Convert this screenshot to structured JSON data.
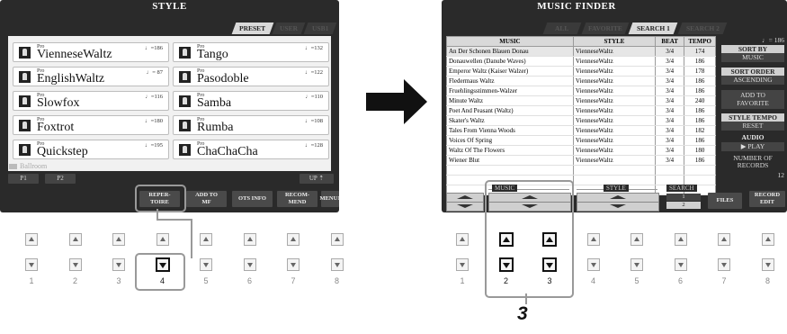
{
  "left_screen": {
    "title": "STYLE",
    "tabs": [
      {
        "label": "PRESET",
        "active": true
      },
      {
        "label": "USER",
        "active": false
      },
      {
        "label": "USB1",
        "active": false
      }
    ],
    "styles": [
      {
        "prefix": "Pro",
        "name": "VienneseWaltz",
        "tempo": "♩=186"
      },
      {
        "prefix": "Pro",
        "name": "Tango",
        "tempo": "♩=132"
      },
      {
        "prefix": "Pro",
        "name": "EnglishWaltz",
        "tempo": "♩= 87"
      },
      {
        "prefix": "Pro",
        "name": "Pasodoble",
        "tempo": "♩=122"
      },
      {
        "prefix": "Pro",
        "name": "Slowfox",
        "tempo": "♩=116"
      },
      {
        "prefix": "Pro",
        "name": "Samba",
        "tempo": "♩=110"
      },
      {
        "prefix": "Pro",
        "name": "Foxtrot",
        "tempo": "♩=180"
      },
      {
        "prefix": "Pro",
        "name": "Rumba",
        "tempo": "♩=108"
      },
      {
        "prefix": "Pro",
        "name": "Quickstep",
        "tempo": "♩=195"
      },
      {
        "prefix": "Pro",
        "name": "ChaChaCha",
        "tempo": "♩=128"
      }
    ],
    "folder": "Ballroom",
    "pages": [
      "P1",
      "P2"
    ],
    "up_label": "UP",
    "bottom_buttons": [
      {
        "label": "REPER-\nTOIRE"
      },
      {
        "label": "ADD TO\nMF"
      },
      {
        "label": "OTS INFO"
      },
      {
        "label": "RECOM-\nMEND"
      },
      {
        "label": "MENU1"
      }
    ]
  },
  "right_screen": {
    "title": "MUSIC FINDER",
    "tabs": [
      {
        "label": "ALL",
        "active": false
      },
      {
        "label": "FAVORITE",
        "active": false
      },
      {
        "label": "SEARCH 1",
        "active": true
      },
      {
        "label": "SEARCH 2",
        "active": false
      }
    ],
    "table": {
      "headers": [
        "MUSIC",
        "STYLE",
        "BEAT",
        "TEMPO"
      ],
      "rows": [
        [
          "An Der Schonen Blauen Donau",
          "VienneseWaltz",
          "3/4",
          "174"
        ],
        [
          "Donauwellen (Danube Waves)",
          "VienneseWaltz",
          "3/4",
          "186"
        ],
        [
          "Emperor Waltz (Kaiser Walzer)",
          "VienneseWaltz",
          "3/4",
          "178"
        ],
        [
          "Fledermaus Waltz",
          "VienneseWaltz",
          "3/4",
          "186"
        ],
        [
          "Fruehlingsstimmen-Walzer",
          "VienneseWaltz",
          "3/4",
          "186"
        ],
        [
          "Minute Waltz",
          "VienneseWaltz",
          "3/4",
          "240"
        ],
        [
          "Poet And Peasant (Waltz)",
          "VienneseWaltz",
          "3/4",
          "186"
        ],
        [
          "Skater's Waltz",
          "VienneseWaltz",
          "3/4",
          "186"
        ],
        [
          "Tales From Vienna Woods",
          "VienneseWaltz",
          "3/4",
          "182"
        ],
        [
          "Voices Of Spring",
          "VienneseWaltz",
          "3/4",
          "186"
        ],
        [
          "Waltz Of The Flowers",
          "VienneseWaltz",
          "3/4",
          "180"
        ],
        [
          "Wiener Blut",
          "VienneseWaltz",
          "3/4",
          "186"
        ]
      ]
    },
    "right_panel": {
      "tempo_display": "♩= 186",
      "sort_by_label": "SORT BY",
      "sort_by_value": "MUSIC",
      "sort_order_label": "SORT ORDER",
      "sort_order_value": "ASCENDING",
      "add_favorite_label": "ADD TO\nFAVORITE",
      "style_tempo_label": "STYLE TEMPO",
      "style_tempo_value": "RESET",
      "audio_label": "AUDIO",
      "audio_value": "▶ PLAY",
      "records_label": "NUMBER OF\nRECORDS",
      "records_value": "12"
    },
    "bottom": {
      "music_label": "MUSIC",
      "style_label": "STYLE",
      "search_label": "SEARCH",
      "search_1": "1",
      "search_2": "2",
      "files_label": "FILES",
      "record_edit_label": "RECORD\nEDIT"
    }
  },
  "button_numbers": [
    "1",
    "2",
    "3",
    "4",
    "5",
    "6",
    "7",
    "8"
  ],
  "step_label": "3"
}
